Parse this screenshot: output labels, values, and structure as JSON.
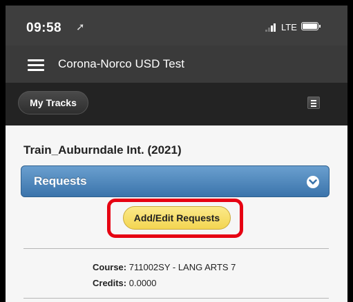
{
  "status_bar": {
    "time": "09:58",
    "carrier_label": "LTE"
  },
  "app_header": {
    "title": "Corona-Norco USD Test"
  },
  "toolbar": {
    "my_tracks_label": "My Tracks"
  },
  "content": {
    "school_title": "Train_Auburndale Int. (2021)",
    "section_title": "Requests",
    "add_edit_label": "Add/Edit Requests",
    "course_label": "Course:",
    "course_value": "711002SY - LANG ARTS 7",
    "credits_label": "Credits:",
    "credits_value": "0.0000"
  },
  "colors": {
    "header_bg": "#3a3a3a",
    "toolbar_bg": "#232323",
    "accent_blue": "#3b74ab",
    "button_yellow": "#f3d551",
    "highlight_red": "#e60012"
  }
}
